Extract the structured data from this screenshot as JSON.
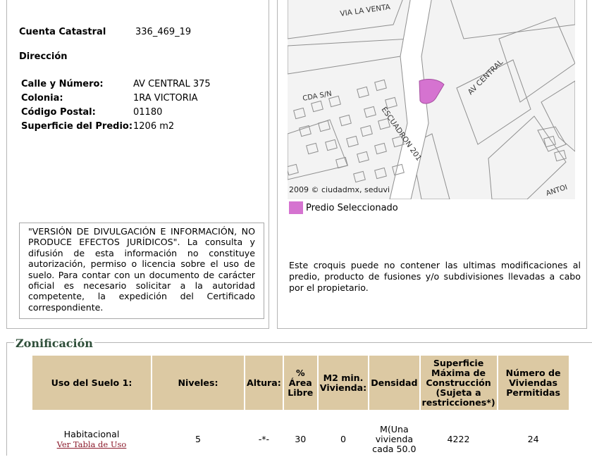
{
  "predio": {
    "cuenta_label": "Cuenta Catastral",
    "cuenta_value": "336_469_19",
    "direccion_title": "Dirección",
    "fields": [
      {
        "label": "Calle y Número:",
        "value": "AV CENTRAL 375"
      },
      {
        "label": "Colonia:",
        "value": "1RA VICTORIA"
      },
      {
        "label": "Código Postal:",
        "value": "01180"
      },
      {
        "label": "Superficie del Predio:",
        "value": "1206 m2"
      }
    ],
    "disclaimer": "\"VERSIÓN DE DIVULGACIÓN E INFORMACIÓN, NO PRODUCE EFECTOS JURÍDICOS\". La consulta y difusión de esta información no constituye autorización, permiso o licencia sobre el uso de suelo. Para contar con un documento de carácter oficial es necesario solicitar a la autoridad competente, la expedición del Certificado correspondiente."
  },
  "map": {
    "streets": [
      "VIA LA VENTA",
      "AV CENTRAL",
      "CDA S/N",
      "ESCUADRON 201",
      "ANTOI"
    ],
    "credit": "2009 © ciudadmx, seduvi",
    "legend_label": "Predio Seleccionado",
    "legend_color": "#d573d0",
    "note": "Este croquis puede no contener las ultimas modificaciones al predio, producto de fusiones y/o subdivisiones llevadas a cabo por el propietario."
  },
  "zonificacion": {
    "title": "Zonificación",
    "headers": [
      "Uso del Suelo 1:",
      "Niveles:",
      "Altura:",
      "% Área Libre",
      "M2 min. Vivienda:",
      "Densidad",
      "Superficie Máxima de Construcción (Sujeta a restricciones*)",
      "Número de Viviendas Permitidas"
    ],
    "row": {
      "uso": "Habitacional",
      "link": "Ver Tabla de Uso",
      "niveles": "5",
      "altura": "-*-",
      "area_libre": "30",
      "m2_min": "0",
      "densidad": "M(Una vivienda cada 50.0",
      "superficie": "4222",
      "viviendas": "24"
    },
    "header_color": "#dcc9a3"
  }
}
